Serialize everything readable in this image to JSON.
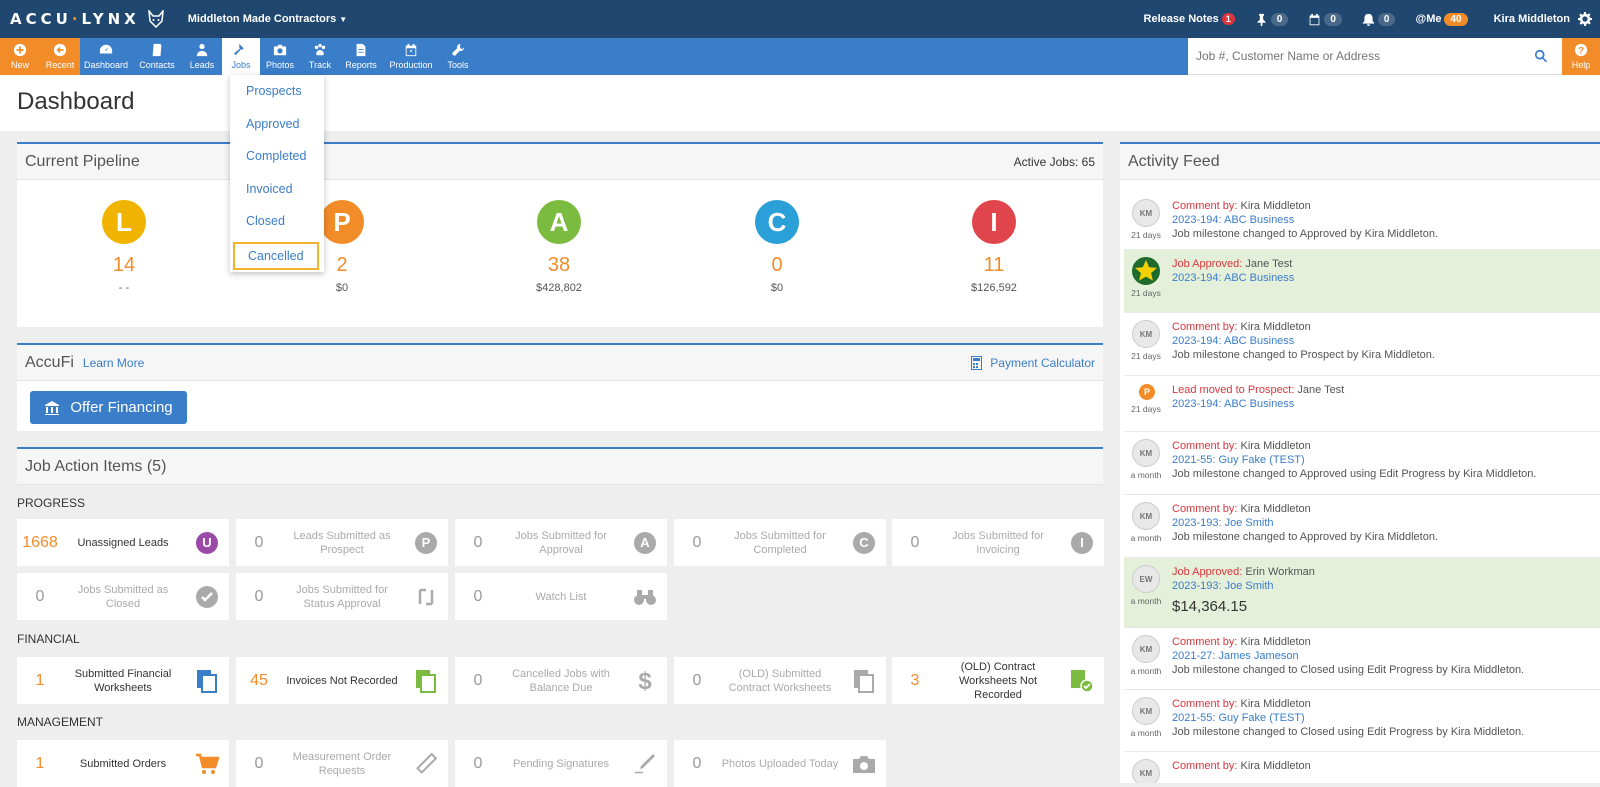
{
  "topbar": {
    "logo_left": "ACCU",
    "logo_right": "LYNX",
    "company": "Middleton Made Contractors",
    "release_notes": "Release Notes",
    "release_count": "1",
    "pin_count": "0",
    "calendar_count": "0",
    "bell_count": "0",
    "me_label": "@Me",
    "me_count": "40",
    "user_name": "Kira Middleton"
  },
  "nav": {
    "new": "New",
    "recent": "Recent",
    "dashboard": "Dashboard",
    "contacts": "Contacts",
    "leads": "Leads",
    "jobs": "Jobs",
    "photos": "Photos",
    "track": "Track",
    "reports": "Reports",
    "production": "Production",
    "tools": "Tools",
    "search_placeholder": "Job #, Customer Name or Address",
    "help": "Help"
  },
  "jobs_menu": [
    "Prospects",
    "Approved",
    "Completed",
    "Invoiced",
    "Closed",
    "Cancelled"
  ],
  "page_title": "Dashboard",
  "pipeline": {
    "title": "Current Pipeline",
    "active_jobs": "Active Jobs: 65",
    "stages": [
      {
        "letter": "L",
        "count": "14",
        "amount": "- -",
        "color": "#f0b400"
      },
      {
        "letter": "P",
        "count": "2",
        "amount": "$0",
        "color": "#f28c28"
      },
      {
        "letter": "A",
        "count": "38",
        "amount": "$428,802",
        "color": "#7bbb3f"
      },
      {
        "letter": "C",
        "count": "0",
        "amount": "$0",
        "color": "#2a9fd8"
      },
      {
        "letter": "I",
        "count": "11",
        "amount": "$126,592",
        "color": "#e0454b"
      }
    ]
  },
  "accufi": {
    "title": "AccuFi",
    "learn_more": "Learn More",
    "payment_calculator": "Payment Calculator",
    "offer_financing": "Offer Financing"
  },
  "job_actions": {
    "title": "Job Action Items (5)",
    "progress_label": "PROGRESS",
    "financial_label": "FINANCIAL",
    "management_label": "MANAGEMENT",
    "progress": [
      {
        "count": "1668",
        "label": "Unassigned Leads",
        "icon": "U",
        "active": true
      },
      {
        "count": "0",
        "label": "Leads Submitted as Prospect",
        "icon": "P",
        "active": false
      },
      {
        "count": "0",
        "label": "Jobs Submitted for Approval",
        "icon": "A",
        "active": false
      },
      {
        "count": "0",
        "label": "Jobs Submitted for Completed",
        "icon": "C",
        "active": false
      },
      {
        "count": "0",
        "label": "Jobs Submitted for Invoicing",
        "icon": "I",
        "active": false
      },
      {
        "count": "0",
        "label": "Jobs Submitted as Closed",
        "icon": "check-icon",
        "active": false
      },
      {
        "count": "0",
        "label": "Jobs Submitted for Status Approval",
        "icon": "status-icon",
        "active": false
      },
      {
        "count": "0",
        "label": "Watch List",
        "icon": "binoculars-icon",
        "active": false
      }
    ],
    "financial": [
      {
        "count": "1",
        "label": "Submitted Financial Worksheets",
        "icon": "worksheet-icon",
        "active": true
      },
      {
        "count": "45",
        "label": "Invoices Not Recorded",
        "icon": "invoice-icon",
        "active": true
      },
      {
        "count": "0",
        "label": "Cancelled Jobs with Balance Due",
        "icon": "dollar-icon",
        "active": false
      },
      {
        "count": "0",
        "label": "(OLD) Submitted Contract Worksheets",
        "icon": "contract-icon",
        "active": false
      },
      {
        "count": "3",
        "label": "(OLD) Contract Worksheets Not Recorded",
        "icon": "contract-check-icon",
        "active": true
      }
    ],
    "management": [
      {
        "count": "1",
        "label": "Submitted Orders",
        "icon": "cart-icon",
        "active": true
      },
      {
        "count": "0",
        "label": "Measurement Order Requests",
        "icon": "ruler-icon",
        "active": false
      },
      {
        "count": "0",
        "label": "Pending Signatures",
        "icon": "pen-icon",
        "active": false
      },
      {
        "count": "0",
        "label": "Photos Uploaded Today",
        "icon": "camera-icon",
        "active": false
      }
    ]
  },
  "activity_feed": {
    "title": "Activity Feed",
    "items": [
      {
        "avatar": "KM",
        "age": "21 days",
        "key": "Comment by:",
        "who": " Kira Middleton",
        "link": "2023-194: ABC Business",
        "desc": "Job milestone changed to Approved by Kira Middleton.",
        "amount": ""
      },
      {
        "avatar": "star",
        "age": "21 days",
        "key": "Job Approved:",
        "who": " Jane Test",
        "link": "2023-194: ABC Business",
        "desc": "",
        "amount": ""
      },
      {
        "avatar": "KM",
        "age": "21 days",
        "key": "Comment by:",
        "who": " Kira Middleton",
        "link": "2023-194: ABC Business",
        "desc": "Job milestone changed to Prospect by Kira Middleton.",
        "amount": ""
      },
      {
        "avatar": "P",
        "age": "21 days",
        "key": "Lead moved to Prospect:",
        "who": " Jane Test",
        "link": "2023-194: ABC Business",
        "desc": "",
        "amount": ""
      },
      {
        "avatar": "KM",
        "age": "a month",
        "key": "Comment by:",
        "who": " Kira Middleton",
        "link": "2021-55: Guy Fake (TEST)",
        "desc": "Job milestone changed to Approved using Edit Progress by Kira Middleton.",
        "amount": ""
      },
      {
        "avatar": "KM",
        "age": "a month",
        "key": "Comment by:",
        "who": " Kira Middleton",
        "link": "2023-193: Joe Smith",
        "desc": "Job milestone changed to Approved by Kira Middleton.",
        "amount": ""
      },
      {
        "avatar": "EW",
        "age": "a month",
        "key": "Job Approved:",
        "who": " Erin Workman",
        "link": "2023-193: Joe Smith",
        "desc": "",
        "amount": "$14,364.15"
      },
      {
        "avatar": "KM",
        "age": "a month",
        "key": "Comment by:",
        "who": " Kira Middleton",
        "link": "2021-27: James Jameson",
        "desc": "Job milestone changed to Closed using Edit Progress by Kira Middleton.",
        "amount": ""
      },
      {
        "avatar": "KM",
        "age": "a month",
        "key": "Comment by:",
        "who": " Kira Middleton",
        "link": "2021-55: Guy Fake (TEST)",
        "desc": "Job milestone changed to Closed using Edit Progress by Kira Middleton.",
        "amount": ""
      },
      {
        "avatar": "KM",
        "age": "",
        "key": "Comment by:",
        "who": " Kira Middleton",
        "link": "",
        "desc": "",
        "amount": ""
      }
    ]
  }
}
